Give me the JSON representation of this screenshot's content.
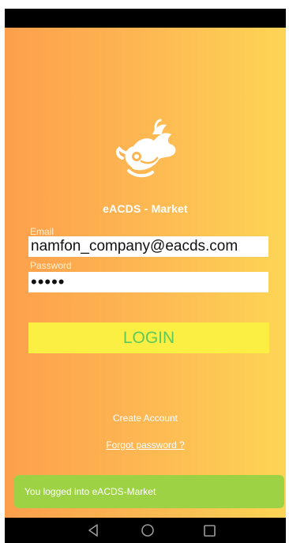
{
  "app": {
    "title": "eACDS - Market"
  },
  "form": {
    "email_label": "Email",
    "email_value": "namfon_company@eacds.com",
    "password_label": "Password",
    "password_display": "•••••"
  },
  "actions": {
    "login_label": "LOGIN",
    "create_account_label": "Create Account",
    "forgot_password_label": "Forgot password ?"
  },
  "toast": {
    "message": "You logged into eACDS-Market"
  },
  "navigation": {
    "buttons": [
      "back-icon",
      "home-icon",
      "recents-icon"
    ]
  },
  "colors": {
    "gradient_left": "#fd9f4c",
    "gradient_right": "#fdd555",
    "login_button_bg": "#fbef43",
    "login_button_text": "#5dc95b",
    "toast_bg": "#9dd245"
  }
}
